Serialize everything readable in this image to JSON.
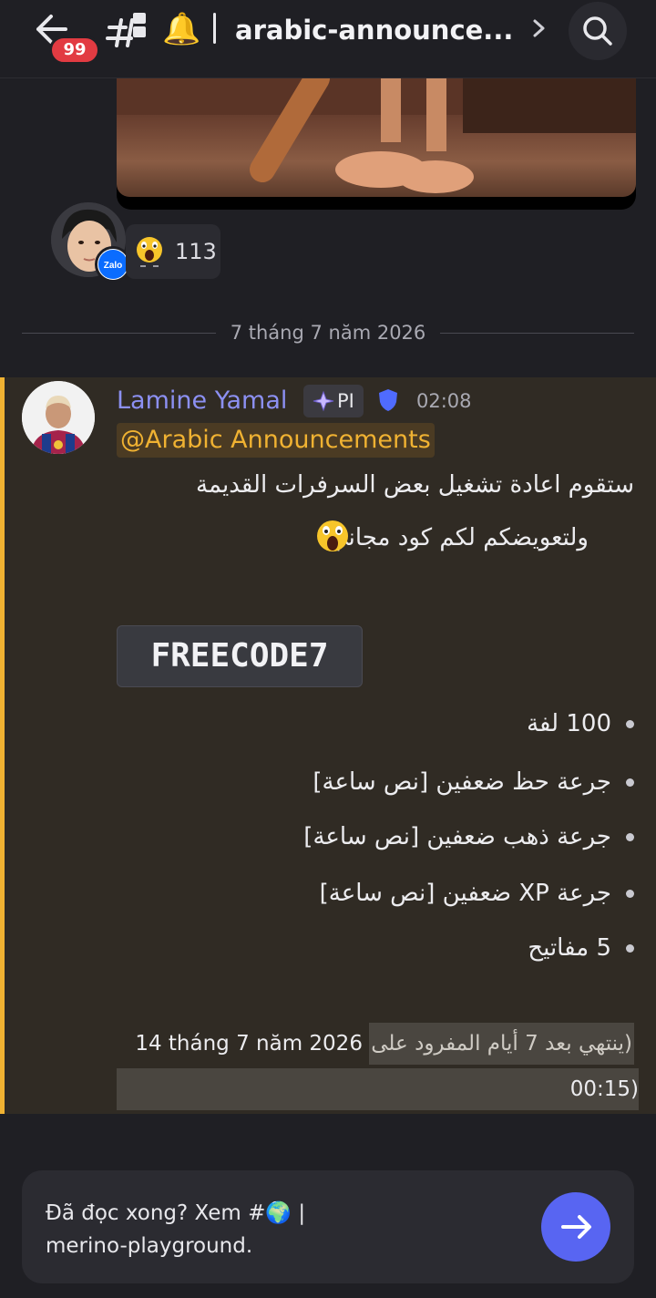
{
  "header": {
    "unread_badge": "99",
    "channel_name": "arabic-announce...",
    "bell_emoji": "🔔"
  },
  "reaction": {
    "avatar_badge": "Zalo",
    "count": "113"
  },
  "date_divider": "7 tháng 7 năm 2026",
  "message": {
    "author": "Lamine Yamal",
    "role_tag": "PI",
    "time": "02:08",
    "mention": "@Arabic Announcements",
    "line1": "ستقوم اعادة تشغيل بعض السرفرات القديمة",
    "line2": "ولتعويضكم لكم كود مجاني",
    "code": "FREECODE7",
    "bullets": [
      "100 لفة",
      "جرعة حظ ضعفين [نص ساعة]",
      "جرعة ذهب ضعفين [نص ساعة]",
      "جرعة XP ضعفين [نص ساعة]",
      "5 مفاتيح"
    ],
    "expiry_prefix": "(ينتهي بعد 7 أيام المفرود على",
    "expiry_date": "14 tháng 7 năm 2026",
    "expiry_time": "00:15)"
  },
  "bottom_bar": {
    "line1_text": "Đã đọc xong? Xem #",
    "line1_emoji": "🌍",
    "line1_bar": "|",
    "line2_text": "merino-playground."
  },
  "colors": {
    "accent": "#5865f2",
    "highlight_border": "#f0b232",
    "mention_text": "#f0b232",
    "author_name": "#8c90f2",
    "badge": "#e23b42"
  }
}
